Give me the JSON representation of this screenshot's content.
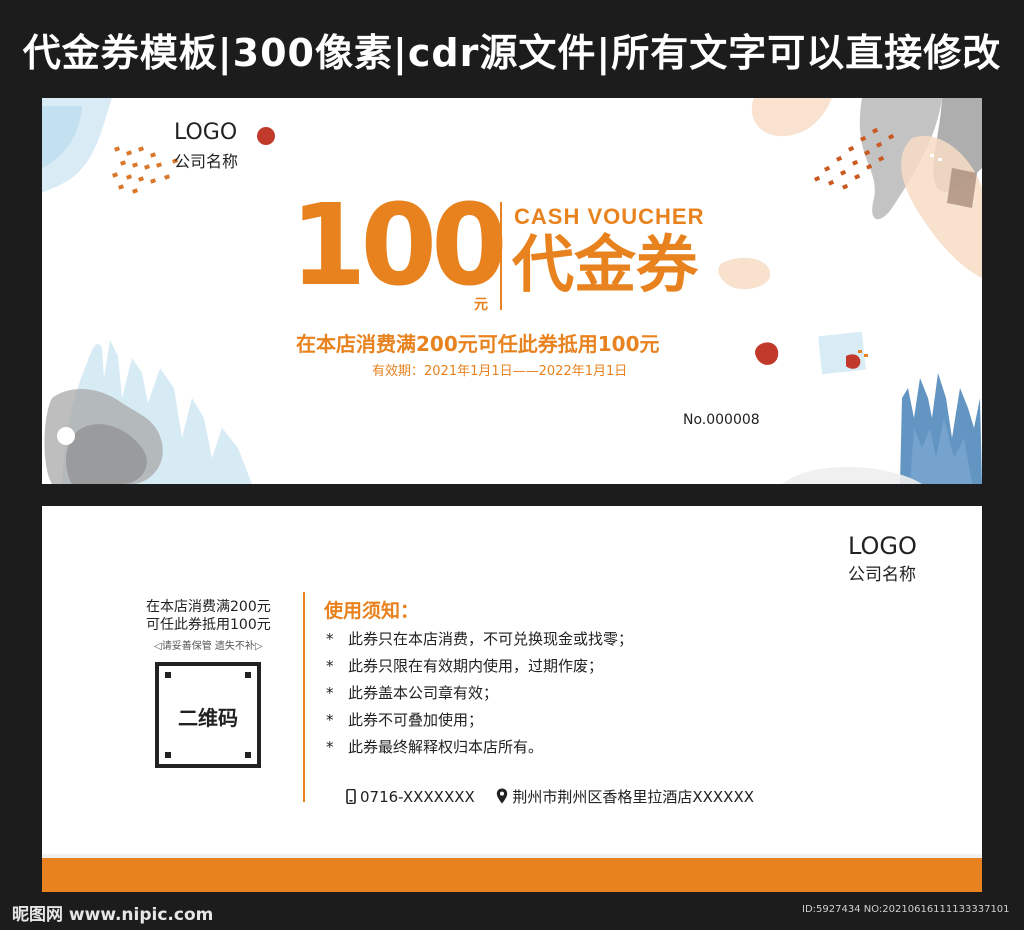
{
  "banner": {
    "title": "代金券模板|300像素|cdr源文件|所有文字可以直接修改"
  },
  "front": {
    "logo": "LOGO",
    "company": "公司名称",
    "amount": "100",
    "unit": "元",
    "cash_label": "CASH VOUCHER",
    "voucher_label": "代金券",
    "terms": "在本店消费满200元可任此券抵用100元",
    "validity": "有效期：2021年1月1日——2022年1月1日",
    "serial": "No.000008"
  },
  "back": {
    "logo": "LOGO",
    "company": "公司名称",
    "left_line_1": "在本店消费满200元",
    "left_line_2": "可任此券抵用100元",
    "left_note": "◁请妥善保管  遗失不补▷",
    "qr_label": "二维码",
    "usage_title": "使用须知：",
    "usage_items": [
      "此券只在本店消费，不可兑换现金或找零；",
      "此券只限在有效期内使用，过期作废；",
      "此券盖本公司章有效；",
      "此券不可叠加使用；",
      "此券最终解释权归本店所有。"
    ],
    "bullet": "*",
    "phone": "0716-XXXXXXX",
    "address": "荆州市荆州区香格里拉酒店XXXXXX",
    "phone_icon": "phone-icon",
    "location_icon": "location-pin-icon"
  },
  "footer": {
    "brand": "昵图网 www.nipic.com",
    "id": "ID:5927434 NO:20210616111133337101"
  },
  "colors": {
    "accent": "#e8821e",
    "dark_background": "#1c1c1c",
    "text": "#222222",
    "deco_blue": "#5b8fc0",
    "deco_gray": "#9a9a9a",
    "deco_red": "#c0392b",
    "deco_light_blue": "#cfe6f2",
    "deco_peach": "#f7dcc4"
  }
}
